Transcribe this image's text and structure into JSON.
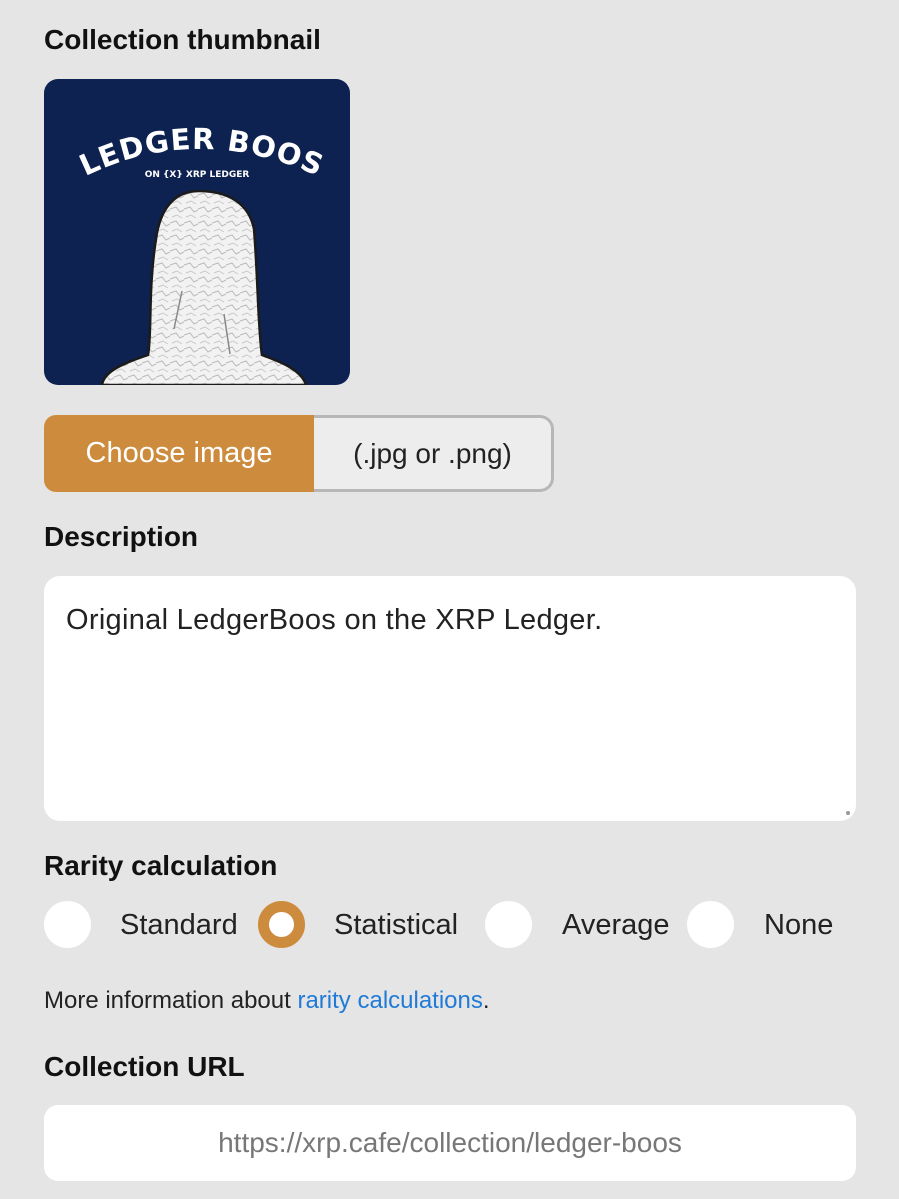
{
  "thumbnail": {
    "label": "Collection thumbnail",
    "title": "LEDGER BOOS",
    "subtitle": "ON {X} XRP LEDGER"
  },
  "file_picker": {
    "button_label": "Choose image",
    "hint": "(.jpg or .png)"
  },
  "description": {
    "label": "Description",
    "value": "Original LedgerBoos on the XRP Ledger."
  },
  "rarity": {
    "label": "Rarity calculation",
    "options": [
      "Standard",
      "Statistical",
      "Average",
      "None"
    ],
    "selected": "Statistical",
    "info_prefix": "More information about ",
    "info_link": "rarity calculations",
    "info_suffix": "."
  },
  "url": {
    "label": "Collection URL",
    "placeholder": "https://xrp.cafe/collection/ledger-boos"
  },
  "colors": {
    "accent": "#cd8c3d",
    "link": "#1f7ad8",
    "thumb_bg": "#0d2250"
  }
}
